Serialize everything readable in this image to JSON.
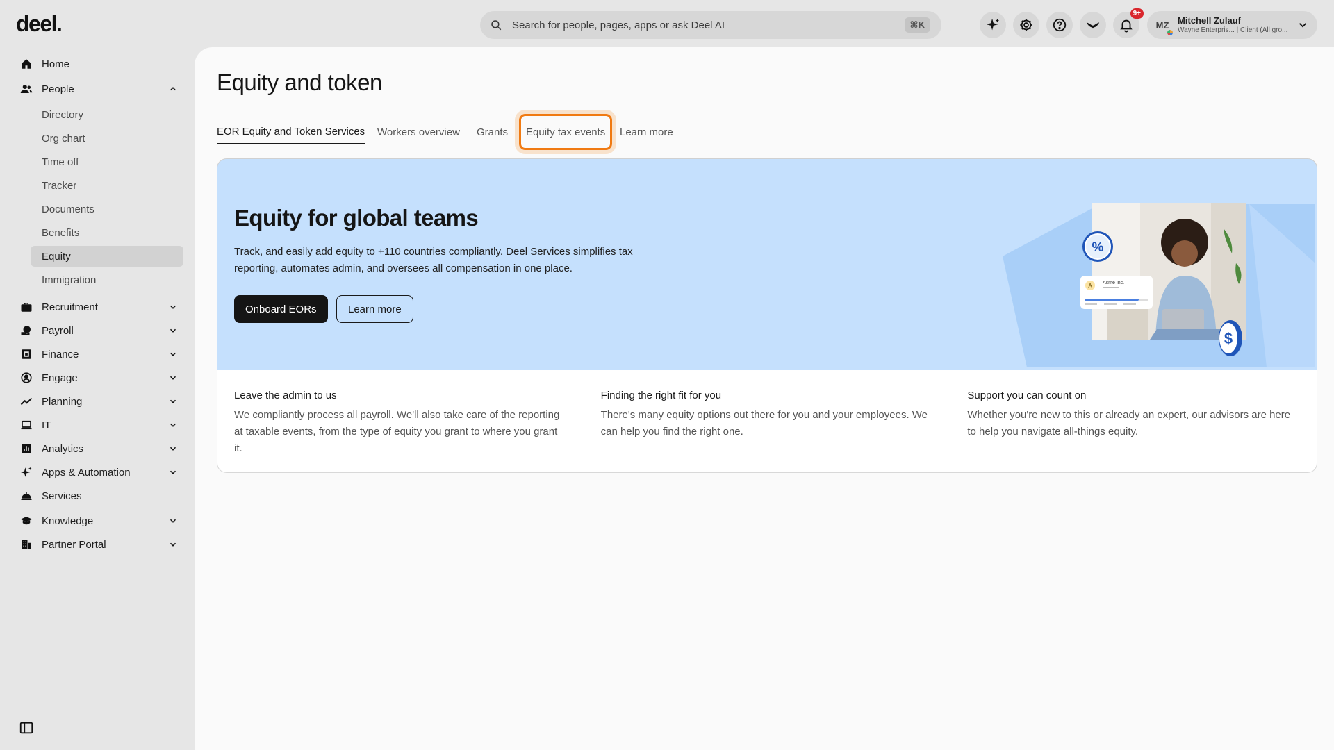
{
  "brand": {
    "logo": "deel."
  },
  "search": {
    "placeholder": "Search for people, pages, apps or ask Deel AI",
    "shortcut": "⌘K"
  },
  "notifications": {
    "badge": "9+"
  },
  "user": {
    "initials": "MZ",
    "name": "Mitchell Zulauf",
    "subtitle": "Wayne Enterpris... | Client (All gro..."
  },
  "sidebar": {
    "items": [
      {
        "label": "Home",
        "icon": "home-icon"
      },
      {
        "label": "People",
        "icon": "people-icon",
        "expanded": true,
        "children": [
          "Directory",
          "Org chart",
          "Time off",
          "Tracker",
          "Documents",
          "Benefits",
          "Equity",
          "Immigration"
        ],
        "active_child": "Equity"
      },
      {
        "label": "Recruitment",
        "icon": "briefcase-icon"
      },
      {
        "label": "Payroll",
        "icon": "payroll-icon"
      },
      {
        "label": "Finance",
        "icon": "finance-icon"
      },
      {
        "label": "Engage",
        "icon": "engage-icon"
      },
      {
        "label": "Planning",
        "icon": "planning-icon"
      },
      {
        "label": "IT",
        "icon": "laptop-icon"
      },
      {
        "label": "Analytics",
        "icon": "analytics-icon"
      },
      {
        "label": "Apps & Automation",
        "icon": "sparkle-icon"
      },
      {
        "label": "Services",
        "icon": "services-icon"
      },
      {
        "label": "Knowledge",
        "icon": "graduation-icon"
      },
      {
        "label": "Partner Portal",
        "icon": "building-icon"
      }
    ]
  },
  "page": {
    "title": "Equity and token",
    "tabs": [
      {
        "label": "EOR Equity and Token Services",
        "state": "active"
      },
      {
        "label": "Workers overview"
      },
      {
        "label": "Grants"
      },
      {
        "label": "Equity tax events",
        "state": "focused"
      },
      {
        "label": "Learn more"
      }
    ]
  },
  "hero": {
    "title": "Equity for global teams",
    "description": "Track, and easily add equity to +110 countries compliantly. Deel Services simplifies tax reporting, automates admin, and oversees all compensation in one place.",
    "primary_button": "Onboard EORs",
    "secondary_button": "Learn more",
    "art_card_title": "Acme Inc.",
    "art_card_initial": "A",
    "background_color": "#c5e0fd"
  },
  "features": [
    {
      "title": "Leave the admin to us",
      "text": "We compliantly process all payroll. We'll also take care of the reporting at taxable events, from the type of equity you grant to where you grant it."
    },
    {
      "title": "Finding the right fit for you",
      "text": "There's many equity options out there for you and your employees. We can help you find the right one."
    },
    {
      "title": "Support you can count on",
      "text": "Whether you're new to this or already an expert, our advisors are here to help you navigate all-things equity."
    }
  ],
  "colors": {
    "focus_ring": "#f07a12",
    "notification_badge": "#d9262c",
    "primary_button": "#151515"
  }
}
